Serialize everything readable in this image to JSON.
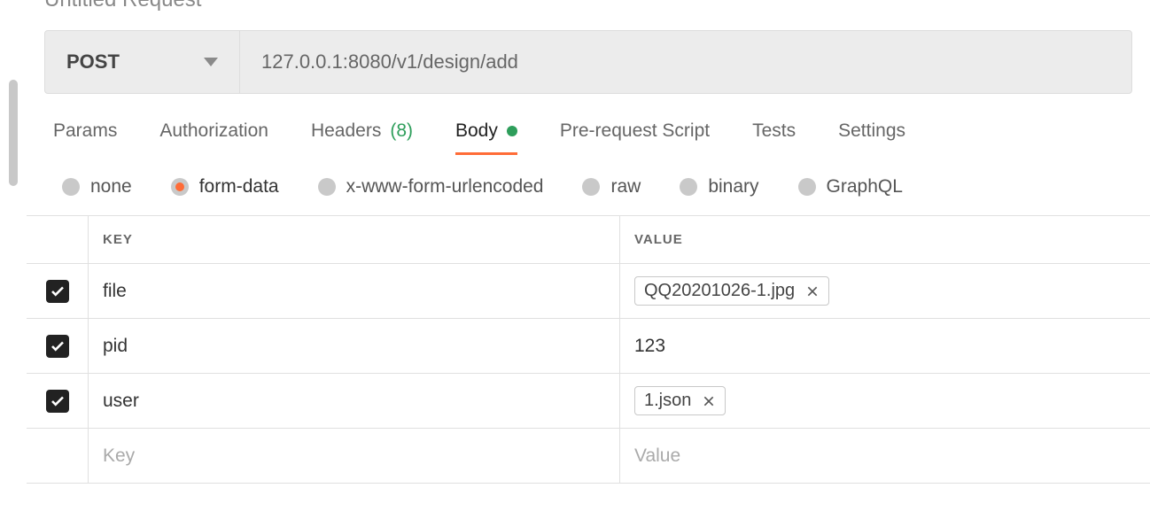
{
  "page": {
    "title": "Untitled Request"
  },
  "request": {
    "method": "POST",
    "url": "127.0.0.1:8080/v1/design/add"
  },
  "tabs": {
    "params": "Params",
    "authorization": "Authorization",
    "headers_label": "Headers",
    "headers_count": "(8)",
    "body": "Body",
    "prerequest": "Pre-request Script",
    "tests": "Tests",
    "settings": "Settings"
  },
  "body_types": {
    "none": "none",
    "form_data": "form-data",
    "urlencoded": "x-www-form-urlencoded",
    "raw": "raw",
    "binary": "binary",
    "graphql": "GraphQL"
  },
  "table": {
    "header_key": "KEY",
    "header_value": "VALUE",
    "placeholder_key": "Key",
    "placeholder_value": "Value",
    "rows": [
      {
        "key": "file",
        "value_file": "QQ20201026-1.jpg"
      },
      {
        "key": "pid",
        "value_text": "123"
      },
      {
        "key": "user",
        "value_file": "1.json"
      }
    ]
  }
}
